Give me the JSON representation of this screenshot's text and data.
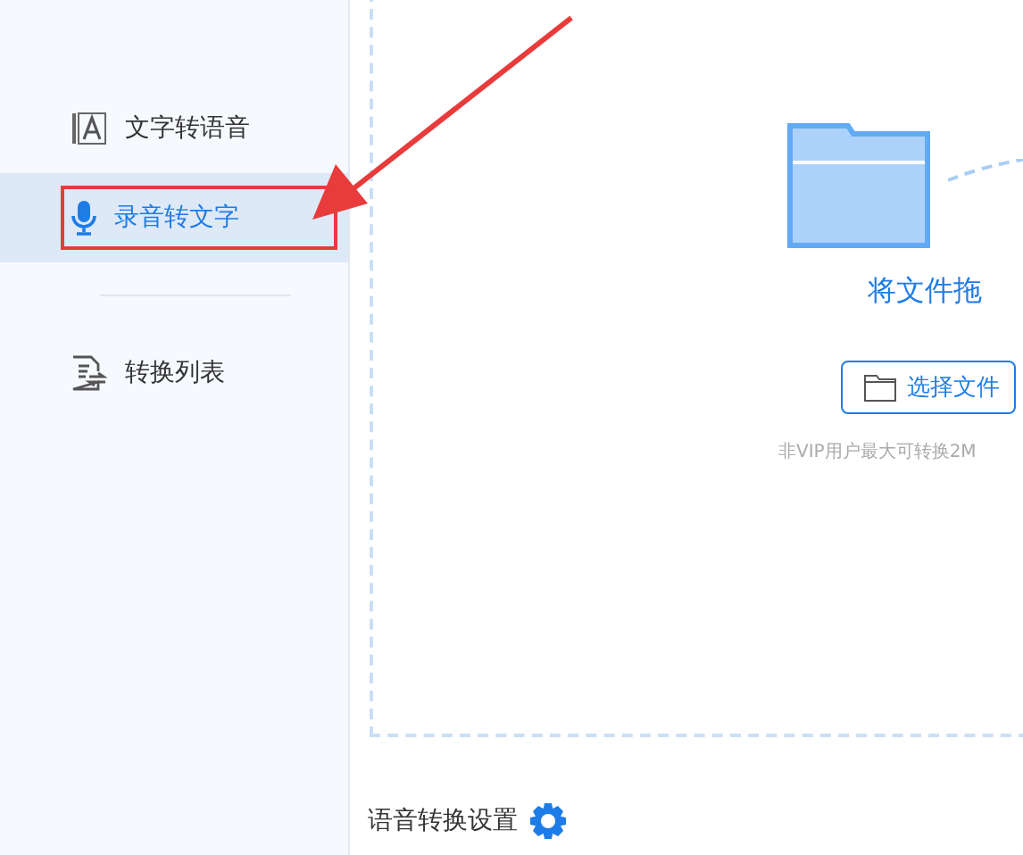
{
  "sidebar": {
    "items": [
      {
        "label": "文字转语音",
        "selected": false
      },
      {
        "label": "录音转文字",
        "selected": true
      },
      {
        "label": "转换列表",
        "selected": false
      }
    ]
  },
  "drop_zone": {
    "title": "将文件拖",
    "button": "选择文件",
    "note": "非VIP用户最大可转换2M"
  },
  "footer": {
    "label": "语音转换设置"
  }
}
